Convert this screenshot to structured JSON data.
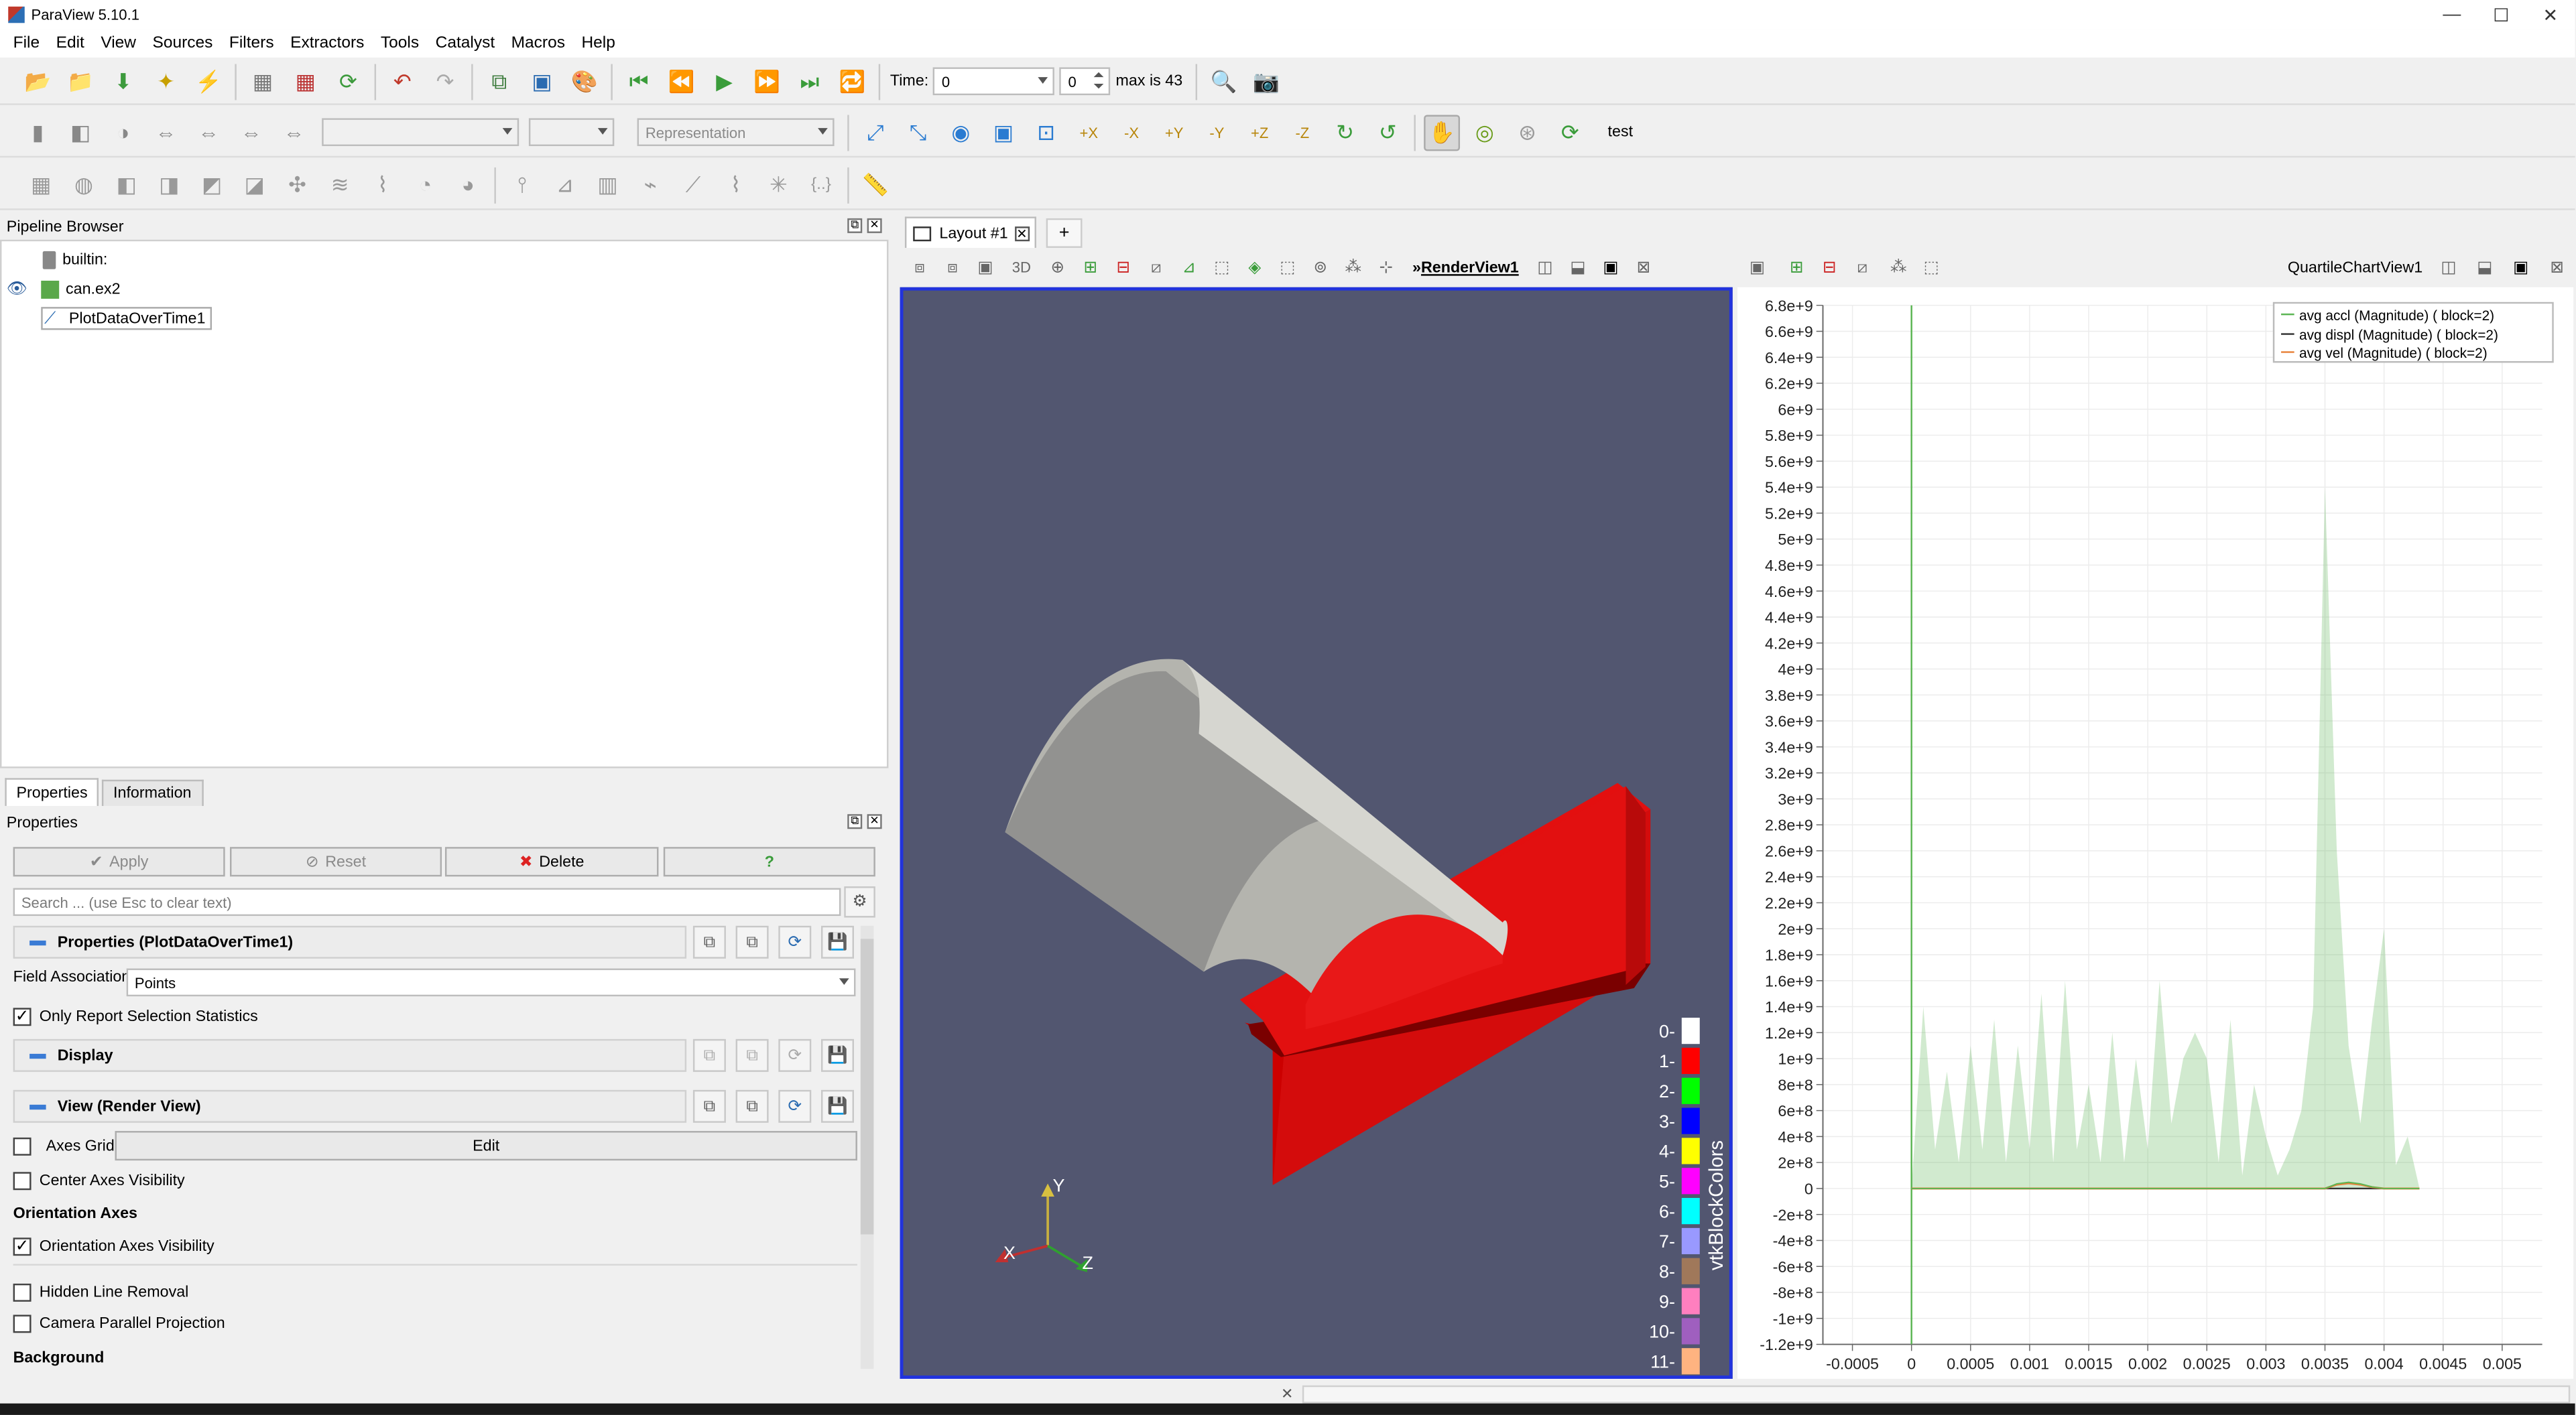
{
  "window": {
    "title": "ParaView 5.10.1"
  },
  "menu": [
    "File",
    "Edit",
    "View",
    "Sources",
    "Filters",
    "Extractors",
    "Tools",
    "Catalyst",
    "Macros",
    "Help"
  ],
  "toolbar": {
    "time_label": "Time:",
    "time_value": "0",
    "step_value": "0",
    "max_label": "max is 43",
    "representation_placeholder": "Representation",
    "preset_label": "test"
  },
  "pipeline": {
    "title": "Pipeline Browser",
    "items": [
      {
        "label": "builtin:",
        "icon": "server-icon"
      },
      {
        "label": "can.ex2",
        "icon": "cube-icon",
        "visible": true
      },
      {
        "label": "PlotDataOverTime1",
        "icon": "line-chart-icon",
        "selected": true
      }
    ]
  },
  "properties": {
    "tabs": [
      "Properties",
      "Information"
    ],
    "title": "Properties",
    "apply": "Apply",
    "reset": "Reset",
    "delete": "Delete",
    "help": "?",
    "search_placeholder": "Search ... (use Esc to clear text)",
    "section_main": "Properties (PlotDataOverTime1)",
    "field_association_label": "Field Association",
    "field_association_value": "Points",
    "only_report_label": "Only Report Selection Statistics",
    "only_report_checked": true,
    "section_display": "Display",
    "section_view": "View (Render View)",
    "axes_grid_label": "Axes Grid",
    "edit_button": "Edit",
    "center_axes_label": "Center Axes Visibility",
    "orientation_axes_group": "Orientation Axes",
    "orientation_axes_visibility_label": "Orientation Axes Visibility",
    "orientation_axes_checked": true,
    "hidden_line_label": "Hidden Line Removal",
    "camera_parallel_label": "Camera Parallel Projection",
    "background_group": "Background"
  },
  "layout": {
    "tab_label": "Layout #1",
    "add_tab": "+",
    "render_view_name": "RenderView1",
    "render_view_3d": "3D",
    "chart_view_name": "QuartileChartView1"
  },
  "render": {
    "colorbar_title": "vtkBlockColors",
    "block_labels": [
      "0",
      "1",
      "2",
      "3",
      "4",
      "5",
      "6",
      "7",
      "8",
      "9",
      "10",
      "11"
    ],
    "block_colors": [
      "#ffffff",
      "#ff0000",
      "#00ff00",
      "#0000ff",
      "#ffff00",
      "#ff00ff",
      "#00ffff",
      "#9999ff",
      "#a0785a",
      "#ff7fbf",
      "#9f5fbf",
      "#ffb380"
    ],
    "axes": {
      "x": "X",
      "y": "Y",
      "z": "Z"
    }
  },
  "chart_data": {
    "type": "area",
    "legend": [
      {
        "name": "avg accl (Magnitude) ( block=2)",
        "color": "#5ab552"
      },
      {
        "name": "avg displ (Magnitude) ( block=2)",
        "color": "#333333"
      },
      {
        "name": "avg vel (Magnitude) ( block=2)",
        "color": "#e8823a"
      }
    ],
    "legend_position": "top-right",
    "ylim": [
      -1200000000.0,
      6800000000.0
    ],
    "xlim": [
      -0.00075,
      0.0052
    ],
    "y_ticks": [
      "6.8e+9",
      "6.6e+9",
      "6.4e+9",
      "6.2e+9",
      "6e+9",
      "5.8e+9",
      "5.6e+9",
      "5.4e+9",
      "5.2e+9",
      "5e+9",
      "4.8e+9",
      "4.6e+9",
      "4.4e+9",
      "4.2e+9",
      "4e+9",
      "3.8e+9",
      "3.6e+9",
      "3.4e+9",
      "3.2e+9",
      "3e+9",
      "2.8e+9",
      "2.6e+9",
      "2.4e+9",
      "2.2e+9",
      "2e+9",
      "1.8e+9",
      "1.6e+9",
      "1.4e+9",
      "1.2e+9",
      "1e+9",
      "8e+8",
      "6e+8",
      "4e+8",
      "2e+8",
      "0",
      "-2e+8",
      "-4e+8",
      "-6e+8",
      "-8e+8",
      "-1e+9",
      "-1.2e+9"
    ],
    "x_ticks": [
      "-0.0005",
      "0",
      "0.0005",
      "0.001",
      "0.0015",
      "0.002",
      "0.0025",
      "0.003",
      "0.0035",
      "0.004",
      "0.0045",
      "0.005"
    ],
    "accl_x": [
      0,
      0.0001,
      0.0002,
      0.0003,
      0.0004,
      0.0005,
      0.0006,
      0.0007,
      0.0008,
      0.0009,
      0.001,
      0.0011,
      0.0012,
      0.0013,
      0.0014,
      0.0015,
      0.0016,
      0.0017,
      0.0018,
      0.0019,
      0.002,
      0.0021,
      0.0022,
      0.0023,
      0.0024,
      0.0025,
      0.0026,
      0.0027,
      0.0028,
      0.0029,
      0.003,
      0.0031,
      0.0032,
      0.0033,
      0.0034,
      0.0035,
      0.0036,
      0.0037,
      0.0038,
      0.0039,
      0.004,
      0.0041,
      0.0042,
      0.0043
    ],
    "accl_max": [
      0,
      1400000000.0,
      300000000.0,
      900000000.0,
      200000000.0,
      1100000000.0,
      300000000.0,
      1300000000.0,
      200000000.0,
      1100000000.0,
      300000000.0,
      1500000000.0,
      200000000.0,
      1600000000.0,
      300000000.0,
      800000000.0,
      200000000.0,
      1200000000.0,
      200000000.0,
      1000000000.0,
      300000000.0,
      1600000000.0,
      500000000.0,
      1000000000.0,
      1200000000.0,
      1000000000.0,
      200000000.0,
      1300000000.0,
      100000000.0,
      800000000.0,
      400000000.0,
      100000000.0,
      300000000.0,
      600000000.0,
      1400000000.0,
      5400000000.0,
      2600000000.0,
      1100000000.0,
      500000000.0,
      1300000000.0,
      2000000000.0,
      180000000.0,
      400000000.0,
      0
    ],
    "displ_values": [
      0,
      0,
      0,
      0,
      0,
      0,
      0,
      0,
      0,
      0,
      0,
      0,
      0,
      0,
      0,
      0,
      0,
      0,
      0,
      0,
      0,
      0,
      0,
      0,
      0,
      0,
      0,
      0,
      0,
      0,
      0,
      0,
      0,
      0,
      0,
      0,
      0,
      0,
      0,
      0,
      0,
      0,
      0,
      0
    ],
    "vel_values": [
      0,
      0,
      0,
      0,
      0,
      0,
      0,
      0,
      0,
      0,
      0,
      0,
      0,
      0,
      0,
      0,
      0,
      0,
      0,
      0,
      0,
      0,
      0,
      0,
      0,
      0,
      0,
      0,
      0,
      0,
      0,
      0,
      0,
      0,
      0,
      0,
      30000000.0,
      40000000.0,
      30000000.0,
      10000000.0,
      0,
      0,
      0,
      0
    ]
  }
}
